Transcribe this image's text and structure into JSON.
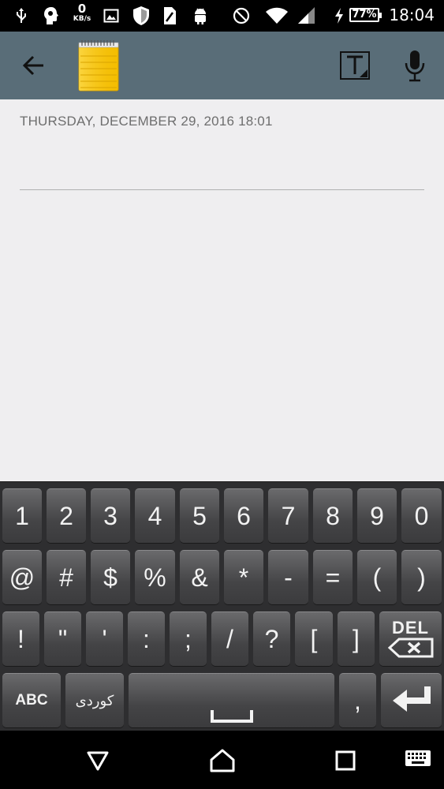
{
  "status_bar": {
    "net_speed_value": "0",
    "net_speed_unit": "KB/s",
    "battery_percent": "77%",
    "time": "18:04",
    "icons": [
      "usb-icon",
      "brain-icon",
      "net-speed",
      "image-icon",
      "shield-icon",
      "sim-icon",
      "android-icon",
      "do-not-disturb-icon",
      "wifi-icon",
      "signal-icon",
      "charging-icon",
      "battery-icon"
    ]
  },
  "app_bar": {
    "background": "#596d78",
    "icons": [
      "back-arrow-icon",
      "notepad-icon",
      "text-format-icon",
      "microphone-icon"
    ]
  },
  "note": {
    "date": "THURSDAY, DECEMBER 29, 2016 18:01",
    "title": "",
    "body": ""
  },
  "keyboard": {
    "row1": [
      "1",
      "2",
      "3",
      "4",
      "5",
      "6",
      "7",
      "8",
      "9",
      "0"
    ],
    "row2": [
      "@",
      "#",
      "$",
      "%",
      "&",
      "*",
      "-",
      "=",
      "(",
      ")"
    ],
    "row3": [
      "!",
      "\"",
      "'",
      ":",
      ";",
      "/",
      "?",
      "[",
      "]"
    ],
    "del_label": "DEL",
    "abc_label": "ABC",
    "kurdish_label": "کوردی",
    "comma_label": ","
  },
  "nav_bar": {
    "icons": [
      "back-triangle-icon",
      "home-icon",
      "recents-icon",
      "keyboard-icon"
    ]
  }
}
